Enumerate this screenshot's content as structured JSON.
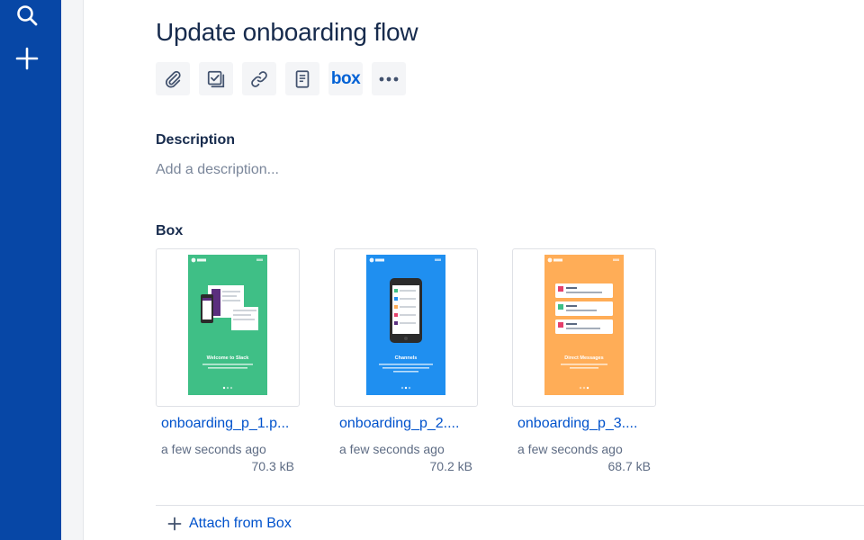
{
  "colors": {
    "sidebar": "#0747a6",
    "accent": "#0052cc",
    "thumb_green": "#3fbf86",
    "thumb_blue": "#1f8ff0",
    "thumb_orange": "#ffad57"
  },
  "sidebar": {
    "icons": [
      "search-icon",
      "plus-icon"
    ]
  },
  "issue": {
    "title": "Update onboarding flow"
  },
  "toolbar": {
    "buttons": [
      "paperclip-icon",
      "checklist-icon",
      "link-icon",
      "page-icon",
      "box-logo",
      "more-icon"
    ],
    "box_label": "box"
  },
  "description": {
    "label": "Description",
    "placeholder": "Add a description..."
  },
  "box": {
    "label": "Box",
    "attachments": [
      {
        "name": "onboarding_p_1.p...",
        "time": "a few seconds ago",
        "size": "70.3 kB",
        "slide_title": "Welcome to Slack",
        "slide_subtitle": "All your team communication in one place, instantly searchable."
      },
      {
        "name": "onboarding_p_2....",
        "time": "a few seconds ago",
        "size": "70.2 kB",
        "slide_title": "Channels",
        "slide_subtitle": "Talk in groups with your coworkers based on departments, projects or shared interests."
      },
      {
        "name": "onboarding_p_3....",
        "time": "a few seconds ago",
        "size": "68.7 kB",
        "slide_title": "Direct Messages",
        "slide_subtitle": "Talk one-on-one with people in your network."
      }
    ],
    "attach_label": "Attach from Box"
  }
}
